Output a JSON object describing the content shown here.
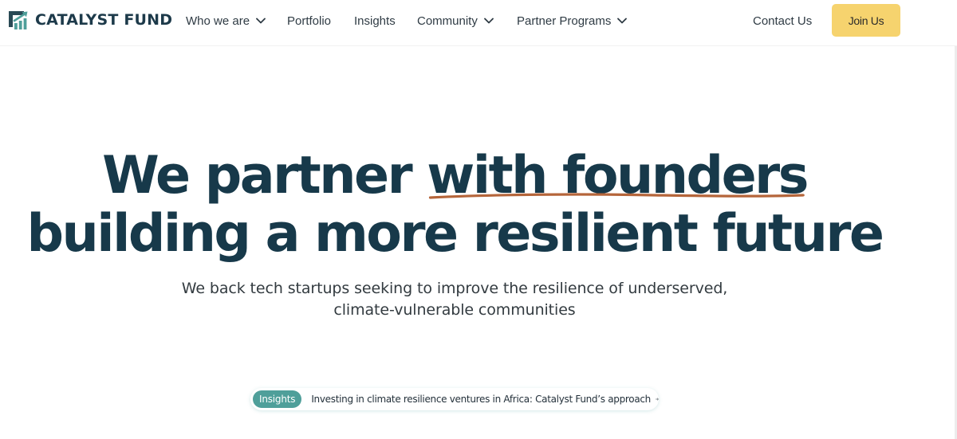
{
  "brand": {
    "name": "CATALYST FUND",
    "colors": {
      "mark_dark": "#2a4a55",
      "mark_teal": "#4f9f9a"
    }
  },
  "nav": {
    "items": [
      {
        "label": "Who we are",
        "has_dropdown": true
      },
      {
        "label": "Portfolio",
        "has_dropdown": false
      },
      {
        "label": "Insights",
        "has_dropdown": false
      },
      {
        "label": "Community",
        "has_dropdown": true
      },
      {
        "label": "Partner Programs",
        "has_dropdown": true
      }
    ],
    "contact_label": "Contact Us",
    "join_label": "Join Us",
    "join_color": "#f6d36e"
  },
  "hero": {
    "line1_plain": "We partner ",
    "line1_highlight": "with founders",
    "line2": "building a more resilient future",
    "underline_color": "#b5653a",
    "subtitle_line1": "We back tech startups seeking to improve the resilience of underserved,",
    "subtitle_line2": "climate-vulnerable communities"
  },
  "announcement": {
    "tag": "Insights",
    "text": "Investing in climate resilience ventures in Africa: Catalyst Fund’s approach",
    "icon": "arrow-right-icon",
    "tag_color": "#4f9f9a"
  }
}
